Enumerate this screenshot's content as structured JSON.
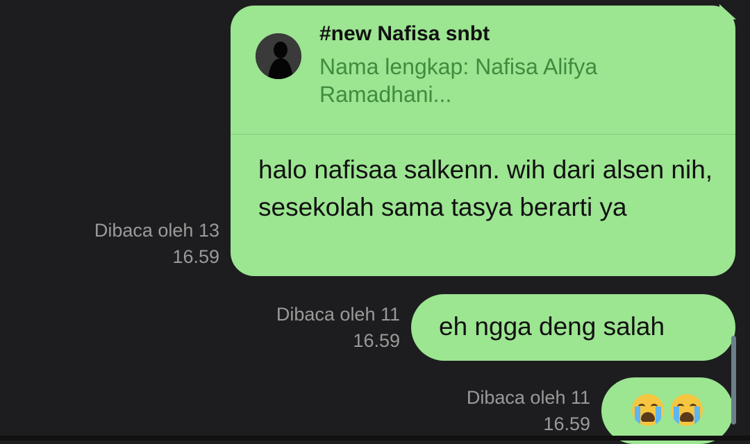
{
  "messages": [
    {
      "reply": {
        "title": "#new Nafisa snbt",
        "snippet": "Nama lengkap: Nafisa Alifya Ramadhani..."
      },
      "text": "halo nafisaa salkenn. wih dari alsen nih, sesekolah sama tasya berarti ya",
      "read_status": "Dibaca oleh 13",
      "time": "16.59"
    },
    {
      "text": "eh ngga deng salah",
      "read_status": "Dibaca oleh 11",
      "time": "16.59"
    },
    {
      "emoji": [
        "crying-face",
        "crying-face"
      ],
      "read_status": "Dibaca oleh 11",
      "time": "16.59"
    }
  ],
  "colors": {
    "background": "#1d1d1f",
    "bubble": "#9ce591",
    "reply_snippet": "#3e8c3f",
    "meta_text": "#9a9a9a"
  }
}
